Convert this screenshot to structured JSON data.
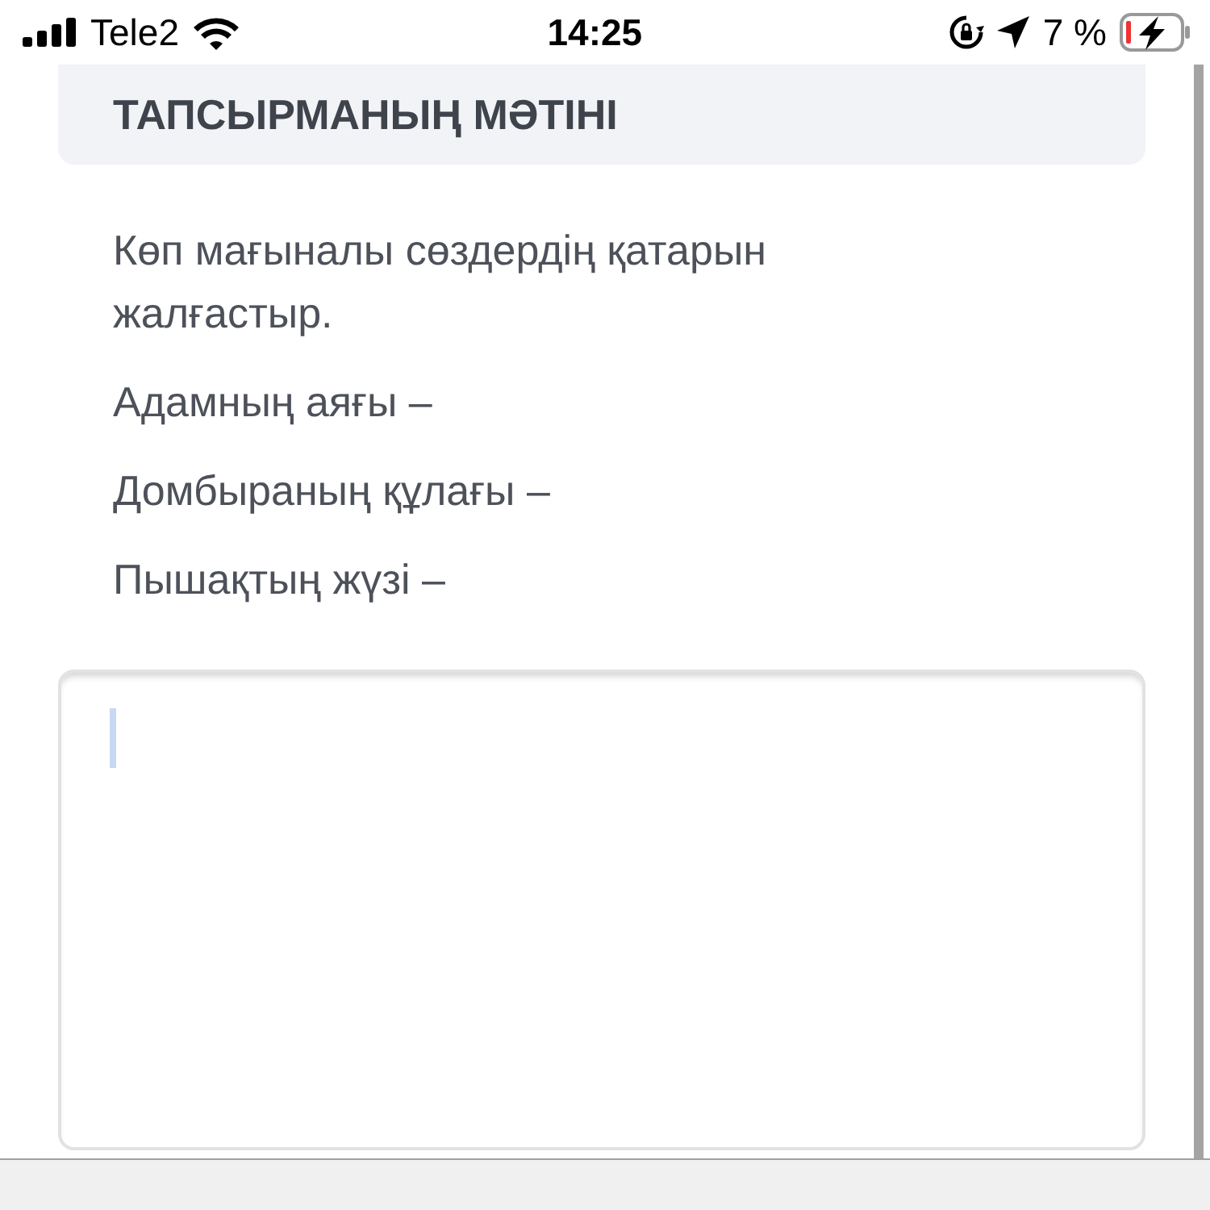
{
  "status_bar": {
    "carrier": "Tele2",
    "time": "14:25",
    "battery": "7 %"
  },
  "section_title": "ТАПСЫРМАНЫҢ МӘТІНІ",
  "task_lines": [
    "Көп мағыналы сөздердің қатарын жалғастыр.",
    "Адамның аяғы –",
    "Домбыраның құлағы –",
    "Пышақтың жүзі –"
  ],
  "answer_field": {
    "focused": true
  }
}
